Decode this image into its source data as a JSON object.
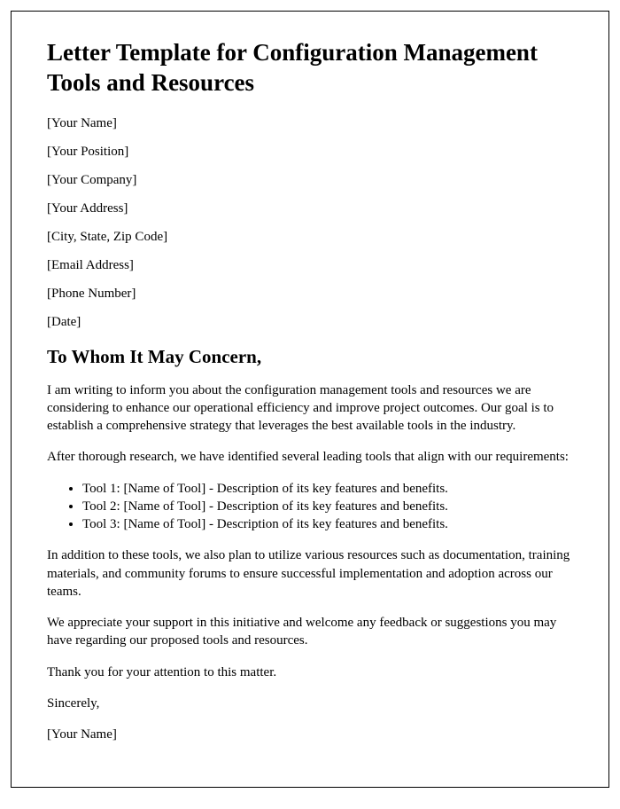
{
  "title": "Letter Template for Configuration Management Tools and Resources",
  "fields": {
    "name": "[Your Name]",
    "position": "[Your Position]",
    "company": "[Your Company]",
    "address": "[Your Address]",
    "city_state_zip": "[City, State, Zip Code]",
    "email": "[Email Address]",
    "phone": "[Phone Number]",
    "date": "[Date]"
  },
  "salutation": "To Whom It May Concern,",
  "body": {
    "p1": "I am writing to inform you about the configuration management tools and resources we are considering to enhance our operational efficiency and improve project outcomes. Our goal is to establish a comprehensive strategy that leverages the best available tools in the industry.",
    "p2": "After thorough research, we have identified several leading tools that align with our requirements:",
    "tools": [
      "Tool 1: [Name of Tool] - Description of its key features and benefits.",
      "Tool 2: [Name of Tool] - Description of its key features and benefits.",
      "Tool 3: [Name of Tool] - Description of its key features and benefits."
    ],
    "p3": "In addition to these tools, we also plan to utilize various resources such as documentation, training materials, and community forums to ensure successful implementation and adoption across our teams.",
    "p4": "We appreciate your support in this initiative and welcome any feedback or suggestions you may have regarding our proposed tools and resources.",
    "p5": "Thank you for your attention to this matter.",
    "closing": "Sincerely,",
    "signature": "[Your Name]"
  }
}
